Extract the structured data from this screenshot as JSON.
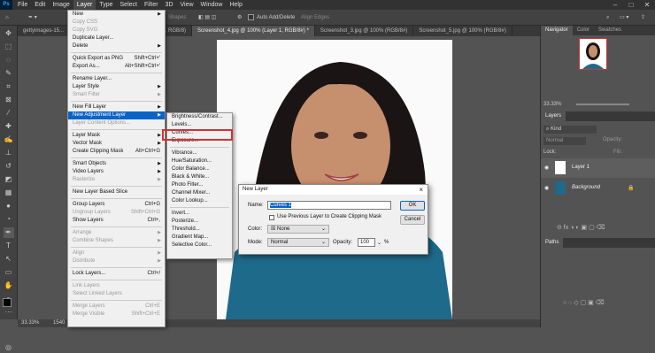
{
  "app": {
    "logo": "Ps"
  },
  "menubar": {
    "items": [
      "File",
      "Edit",
      "Image",
      "Layer",
      "Type",
      "Select",
      "Filter",
      "3D",
      "View",
      "Window",
      "Help"
    ]
  },
  "options": {
    "shapes": "Shapes",
    "auto_add_delete": "Auto Add/Delete",
    "align_edges": "Align Edges"
  },
  "tabs": [
    "gettyimages-15...",
    "...ed, RGB/8)",
    "Screenshot_4.jpg @ 100% (Layer 1, RGB/8#) *",
    "Screenshot_3.jpg @ 100% (RGB/8#)",
    "Screenshot_5.jpg @ 100% (RGB/8#)"
  ],
  "status": {
    "zoom": "33.33%",
    "dims": "1540"
  },
  "layer_menu": {
    "items": [
      {
        "label": "New",
        "arrow": true
      },
      {
        "label": "Copy CSS",
        "disabled": true
      },
      {
        "label": "Copy SVG",
        "disabled": true
      },
      {
        "label": "Duplicate Layer..."
      },
      {
        "label": "Delete",
        "arrow": true
      },
      {
        "sep": true
      },
      {
        "label": "Quick Export as PNG",
        "shortcut": "Shift+Ctrl+'"
      },
      {
        "label": "Export As...",
        "shortcut": "Alt+Shift+Ctrl+'"
      },
      {
        "sep": true
      },
      {
        "label": "Rename Layer..."
      },
      {
        "label": "Layer Style",
        "arrow": true
      },
      {
        "label": "Smart Filter",
        "disabled": true,
        "arrow": true
      },
      {
        "sep": true
      },
      {
        "label": "New Fill Layer",
        "arrow": true
      },
      {
        "label": "New Adjustment Layer",
        "arrow": true,
        "highlight": true
      },
      {
        "label": "Layer Content Options...",
        "disabled": true
      },
      {
        "sep": true
      },
      {
        "label": "Layer Mask",
        "arrow": true
      },
      {
        "label": "Vector Mask",
        "arrow": true
      },
      {
        "label": "Create Clipping Mask",
        "shortcut": "Alt+Ctrl+G"
      },
      {
        "sep": true
      },
      {
        "label": "Smart Objects",
        "arrow": true
      },
      {
        "label": "Video Layers",
        "arrow": true
      },
      {
        "label": "Rasterize",
        "disabled": true,
        "arrow": true
      },
      {
        "sep": true
      },
      {
        "label": "New Layer Based Slice"
      },
      {
        "sep": true
      },
      {
        "label": "Group Layers",
        "shortcut": "Ctrl+G"
      },
      {
        "label": "Ungroup Layers",
        "disabled": true,
        "shortcut": "Shift+Ctrl+G"
      },
      {
        "label": "Show Layers",
        "shortcut": "Ctrl+,"
      },
      {
        "sep": true
      },
      {
        "label": "Arrange",
        "disabled": true,
        "arrow": true
      },
      {
        "label": "Combine Shapes",
        "disabled": true,
        "arrow": true
      },
      {
        "sep": true
      },
      {
        "label": "Align",
        "disabled": true,
        "arrow": true
      },
      {
        "label": "Distribute",
        "disabled": true,
        "arrow": true
      },
      {
        "sep": true
      },
      {
        "label": "Lock Layers...",
        "shortcut": "Ctrl+/"
      },
      {
        "sep": true
      },
      {
        "label": "Link Layers",
        "disabled": true
      },
      {
        "label": "Select Linked Layers",
        "disabled": true
      },
      {
        "sep": true
      },
      {
        "label": "Merge Layers",
        "disabled": true,
        "shortcut": "Ctrl+E"
      },
      {
        "label": "Merge Visible",
        "disabled": true,
        "shortcut": "Shift+Ctrl+E"
      }
    ]
  },
  "adjust_submenu": {
    "items": [
      {
        "label": "Brightness/Contrast..."
      },
      {
        "label": "Levels..."
      },
      {
        "label": "Curves...",
        "boxed": true
      },
      {
        "label": "Exposure..."
      },
      {
        "sep": true
      },
      {
        "label": "Vibrance..."
      },
      {
        "label": "Hue/Saturation..."
      },
      {
        "label": "Color Balance..."
      },
      {
        "label": "Black & White..."
      },
      {
        "label": "Photo Filter..."
      },
      {
        "label": "Channel Mixer..."
      },
      {
        "label": "Color Lookup..."
      },
      {
        "sep": true
      },
      {
        "label": "Invert..."
      },
      {
        "label": "Posterize..."
      },
      {
        "label": "Threshold..."
      },
      {
        "label": "Gradient Map..."
      },
      {
        "label": "Selective Color..."
      }
    ]
  },
  "dialog": {
    "title": "New Layer",
    "name_label": "Name:",
    "name_value": "Curves 1",
    "ok": "OK",
    "cancel": "Cancel",
    "clip_label": "Use Previous Layer to Create Clipping Mask",
    "color_label": "Color:",
    "color_value": "None",
    "mode_label": "Mode:",
    "mode_value": "Normal",
    "opacity_label": "Opacity:",
    "opacity_value": "100",
    "opacity_unit": "%"
  },
  "panels": {
    "nav_tabs": [
      "Navigator",
      "Color",
      "Swatches"
    ],
    "nav_zoom": "33.33%",
    "layers_tab": "Layers",
    "kind": "Kind",
    "blend": "Normal",
    "opacity_label": "Opacity:",
    "lock_label": "Lock:",
    "fill_label": "Fill:",
    "layers": [
      {
        "name": "Layer 1"
      },
      {
        "name": "Background"
      }
    ],
    "paths_tab": "Paths"
  },
  "colors": {
    "highlight": "#0a64c8",
    "box": "#d93030",
    "teal": "#1e6a8a"
  }
}
